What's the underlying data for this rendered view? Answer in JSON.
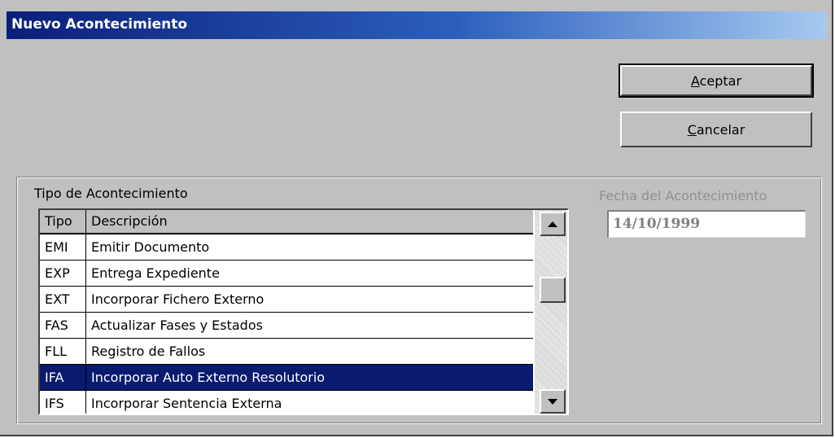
{
  "window": {
    "title": "Nuevo Acontecimiento"
  },
  "buttons": {
    "accept_label": "Aceptar",
    "cancel_label": "Cancelar"
  },
  "group": {
    "label": "Tipo de Acontecimiento"
  },
  "table": {
    "columns": [
      "Tipo",
      "Descripción"
    ],
    "rows": [
      {
        "tipo": "EMI",
        "descripcion": "Emitir Documento"
      },
      {
        "tipo": "EXP",
        "descripcion": "Entrega Expediente"
      },
      {
        "tipo": "EXT",
        "descripcion": "Incorporar Fichero Externo"
      },
      {
        "tipo": "FAS",
        "descripcion": "Actualizar Fases y Estados"
      },
      {
        "tipo": "FLL",
        "descripcion": "Registro de Fallos"
      },
      {
        "tipo": "IFA",
        "descripcion": "Incorporar Auto Externo Resolutorio"
      },
      {
        "tipo": "IFS",
        "descripcion": "Incorporar Sentencia Externa"
      }
    ],
    "selected_tipo": "IFA"
  },
  "date": {
    "label": "Fecha del Acontecimiento",
    "value": "14/10/1999"
  },
  "icons": {
    "scroll_up": "scroll-up-arrow-icon",
    "scroll_down": "scroll-down-arrow-icon"
  },
  "colors": {
    "selection": "#0a1a6e",
    "title_bar_start": "#0a1f7a",
    "title_bar_end": "#a6caf0",
    "disabled_text": "#808080"
  }
}
